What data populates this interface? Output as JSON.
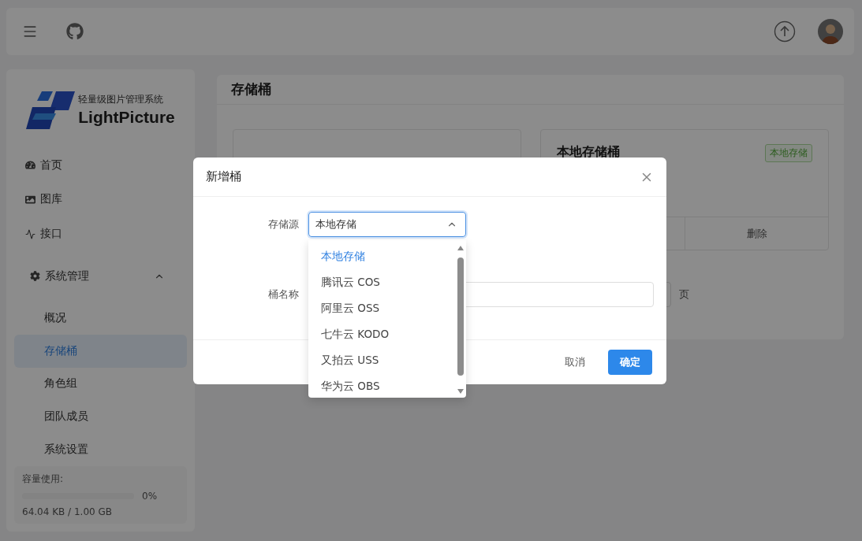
{
  "sidebar": {
    "logo": {
      "subtitle": "轻量级图片管理系统",
      "name": "LightPicture"
    },
    "items": [
      {
        "label": "首页",
        "kind": "gauge",
        "selected": false
      },
      {
        "label": "图库",
        "kind": "image",
        "selected": false
      },
      {
        "label": "接口",
        "kind": "chart",
        "selected": false
      },
      {
        "label": "系统管理",
        "kind": "gear",
        "expanded": true,
        "children": [
          {
            "label": "概况",
            "selected": false
          },
          {
            "label": "存储桶",
            "selected": true
          },
          {
            "label": "角色组",
            "selected": false
          },
          {
            "label": "团队成员",
            "selected": false
          },
          {
            "label": "系统设置",
            "selected": false
          }
        ]
      }
    ],
    "usage": {
      "label": "容量使用:",
      "level": 0,
      "percent": "0%",
      "amount": "64.04 KB / 1.00 GB"
    }
  },
  "page": {
    "title": "存储桶",
    "card": {
      "title": "本地存储桶",
      "tag": "本地存储",
      "action": "删除"
    },
    "pager_suffix": "页"
  },
  "dialog": {
    "title": "新增桶",
    "fields": [
      {
        "label": "存储源",
        "kind": "select",
        "value": "本地存储",
        "open": true
      },
      {
        "label": "桶名称",
        "kind": "input"
      }
    ],
    "options": [
      {
        "label": "本地存储",
        "selected": true
      },
      {
        "label": "腾讯云 COS",
        "selected": false
      },
      {
        "label": "阿里云 OSS",
        "selected": false
      },
      {
        "label": "七牛云 KODO",
        "selected": false
      },
      {
        "label": "又拍云 USS",
        "selected": false
      },
      {
        "label": "华为云 OBS",
        "selected": false
      }
    ],
    "buttons": [
      {
        "label": "取消",
        "kind": "default"
      },
      {
        "label": "确定",
        "kind": "primary"
      }
    ]
  }
}
